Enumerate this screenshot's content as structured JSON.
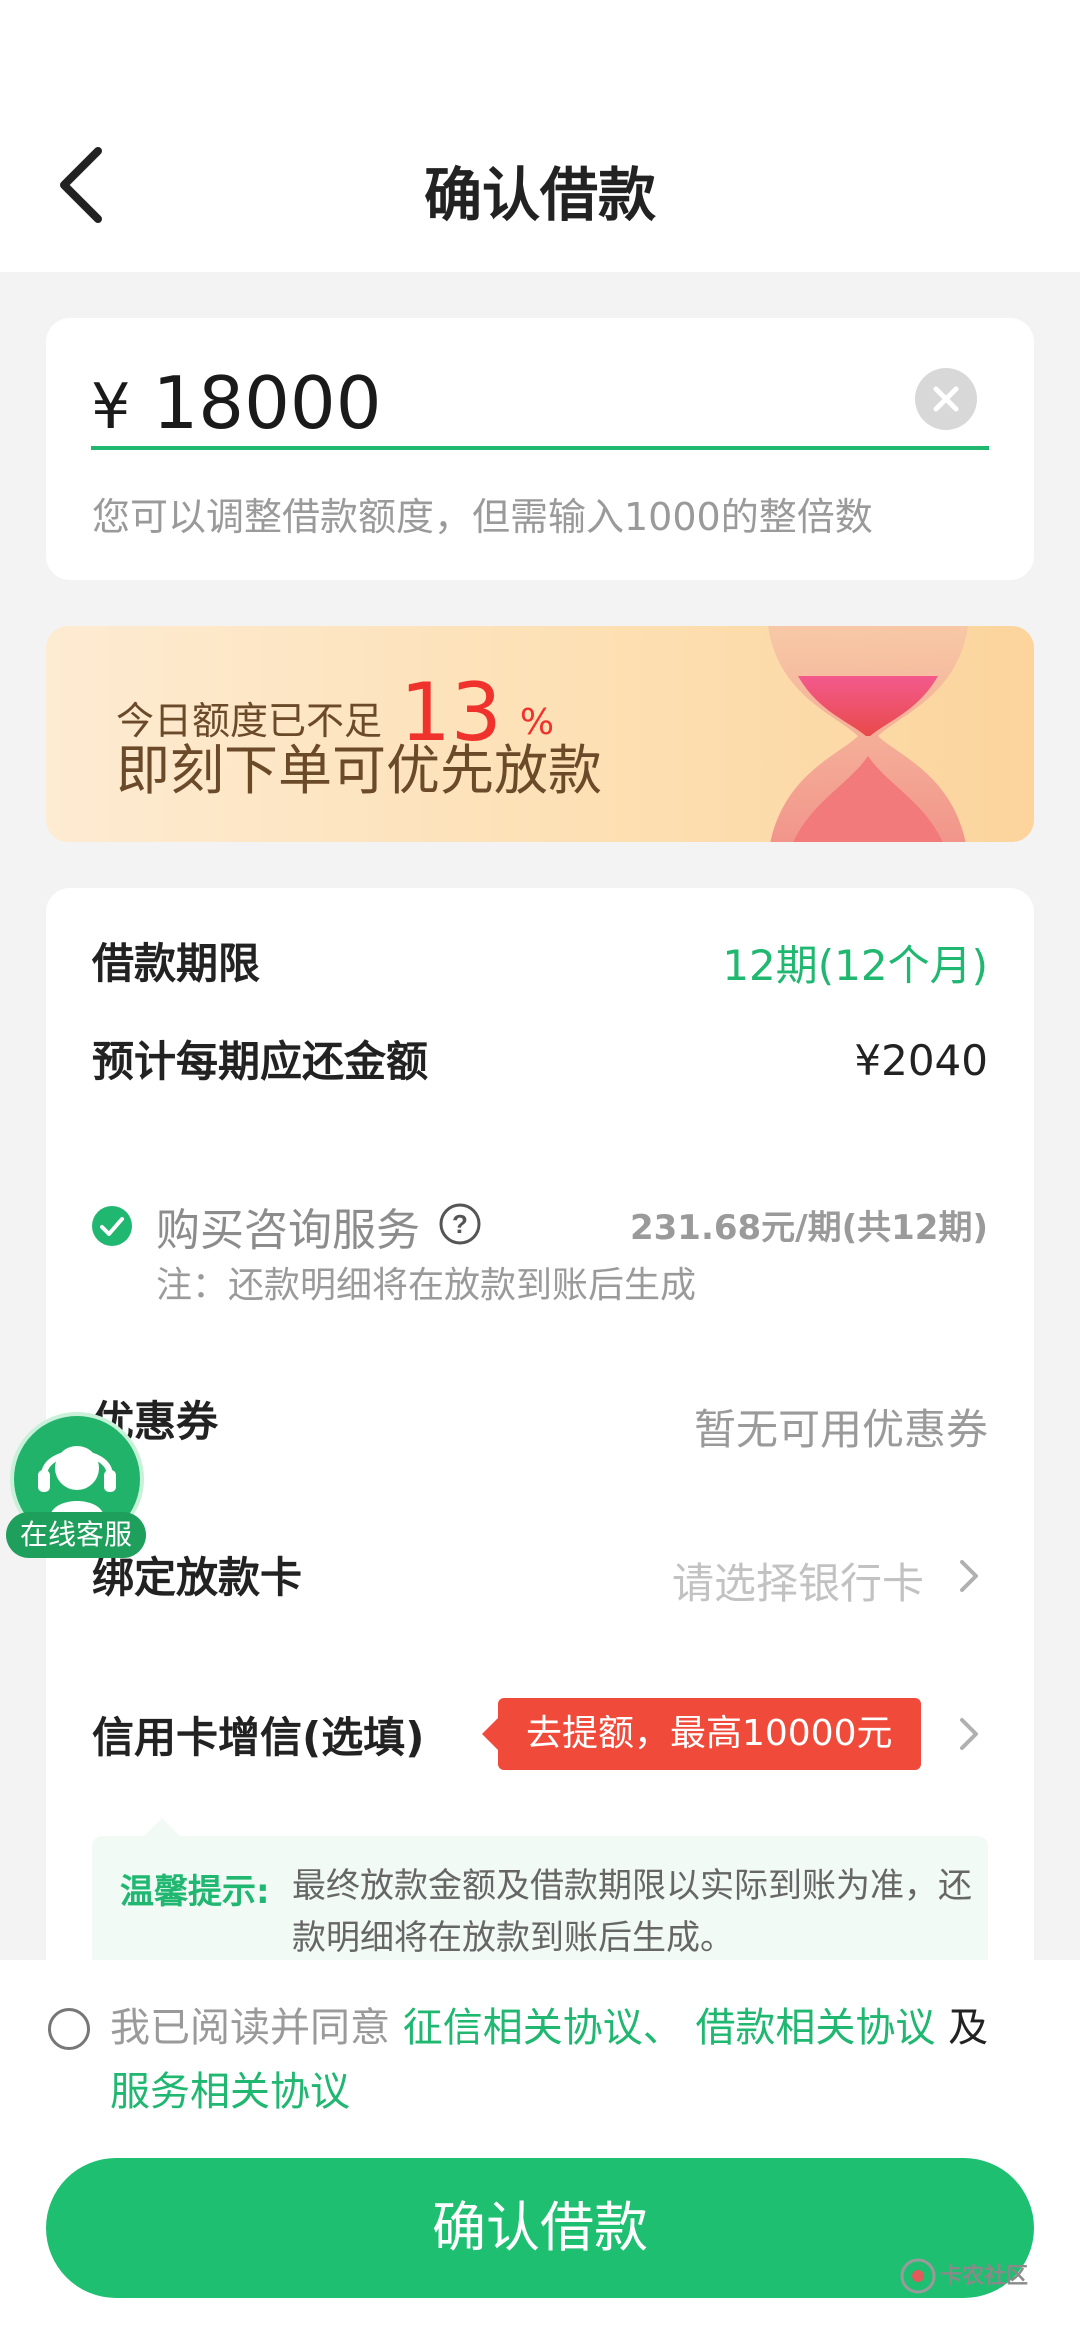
{
  "header": {
    "title": "确认借款"
  },
  "amount": {
    "currency_symbol": "¥",
    "value": "18000",
    "hint": "您可以调整借款额度，但需输入1000的整倍数"
  },
  "banner": {
    "line1_prefix": "今日额度已不足",
    "percent": "13",
    "percent_unit": "%",
    "line2": "即刻下单可优先放款"
  },
  "details": {
    "term_label": "借款期限",
    "term_value": "12期(12个月)",
    "repay_label": "预计每期应还金额",
    "repay_value": "¥2040",
    "service_label": "购买咨询服务",
    "service_price": "231.68元/期(共12期)",
    "service_note": "注：还款明细将在放款到账后生成",
    "coupon_label": "优惠券",
    "coupon_value": "暂无可用优惠券",
    "card_label": "绑定放款卡",
    "card_placeholder": "请选择银行卡",
    "credit_label": "信用卡增信(选填)",
    "credit_promo": "去提额，最高10000元"
  },
  "tip": {
    "title": "温馨提示:",
    "text": "最终放款金额及借款期限以实际到账为准，还款明细将在放款到账后生成。"
  },
  "agreement": {
    "prefix": "我已阅读并同意",
    "link1": "征信相关协议、",
    "link2": "借款相关协议",
    "joiner": "及",
    "link3": "服务相关协议"
  },
  "confirm_button": "确认借款",
  "customer_service": {
    "label": "在线客服"
  },
  "watermark": {
    "text": "卡农社区"
  },
  "colors": {
    "accent": "#1ebf71",
    "warning": "#f04a3a"
  }
}
